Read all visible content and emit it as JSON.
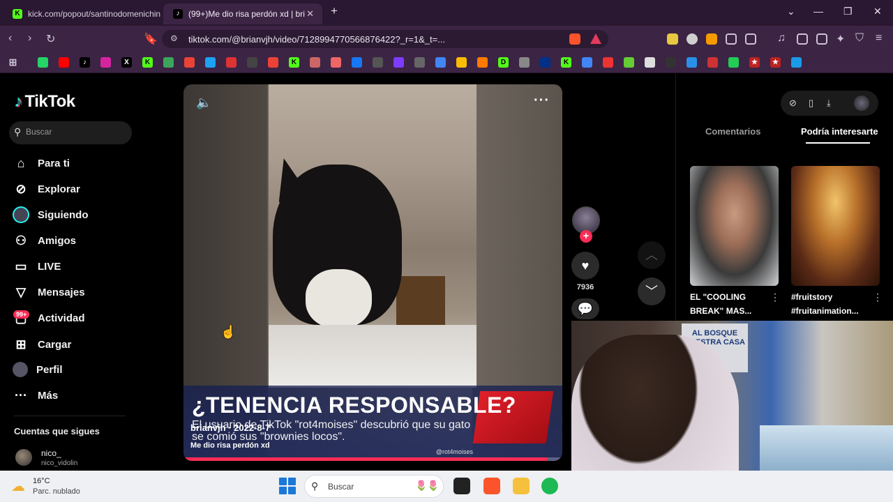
{
  "browser": {
    "tabs": [
      {
        "label": "kick.com/popout/santinodomenichin",
        "favicon": "kick-icon",
        "active": false
      },
      {
        "label": "(99+)Me dio risa perdón xd | bri",
        "favicon": "tiktok-icon",
        "active": true
      }
    ],
    "url": "tiktok.com/@brianvjh/video/7128994770566876422?_r=1&_t=..."
  },
  "tiktok": {
    "brand": "TikTok",
    "search_placeholder": "Buscar",
    "nav": [
      {
        "label": "Para ti",
        "icon": "home-icon"
      },
      {
        "label": "Explorar",
        "icon": "compass-icon"
      },
      {
        "label": "Siguiendo",
        "icon": "following-avatar-icon"
      },
      {
        "label": "Amigos",
        "icon": "friends-icon"
      },
      {
        "label": "LIVE",
        "icon": "live-icon"
      },
      {
        "label": "Mensajes",
        "icon": "message-icon"
      },
      {
        "label": "Actividad",
        "icon": "activity-icon"
      },
      {
        "label": "Cargar",
        "icon": "upload-icon"
      },
      {
        "label": "Perfil",
        "icon": "profile-avatar-icon"
      },
      {
        "label": "Más",
        "icon": "more-icon"
      }
    ],
    "activity_badge": "99+",
    "following_section_title": "Cuentas que sigues",
    "following_account": {
      "name": "nico_",
      "handle": "nico_vidolin"
    },
    "video": {
      "overlay_headline": "¿TENENCIA RESPONSABLE?",
      "overlay_subtext": "El usuario de TikTok \"rot4moises\" descubrió que su gato se comió sus \"brownies locos\".",
      "author": "brianvjh",
      "author_date": "2022-8-7",
      "caption": "Me dio risa perdón xd",
      "watermark": "@rot4moises",
      "progress": 0.96,
      "like_count": "7936"
    },
    "right_panel": {
      "tabs": [
        "Comentarios",
        "Podría interesarte"
      ],
      "active_tab": "Podría interesarte",
      "suggestions": [
        {
          "title": "EL \"COOLING BREAK\" MAS..."
        },
        {
          "title": "#fruitstory #fruitanimation..."
        }
      ]
    }
  },
  "webcam": {
    "sign_text": "AL BOSQUE NUESTRA CASA"
  },
  "taskbar": {
    "weather_temp": "16°C",
    "weather_desc": "Parc. nublado",
    "search_label": "Buscar"
  },
  "colors": {
    "accent": "#fe2c55",
    "tiktok_cyan": "#25f4ee",
    "chrome_purple": "#3c2445"
  }
}
